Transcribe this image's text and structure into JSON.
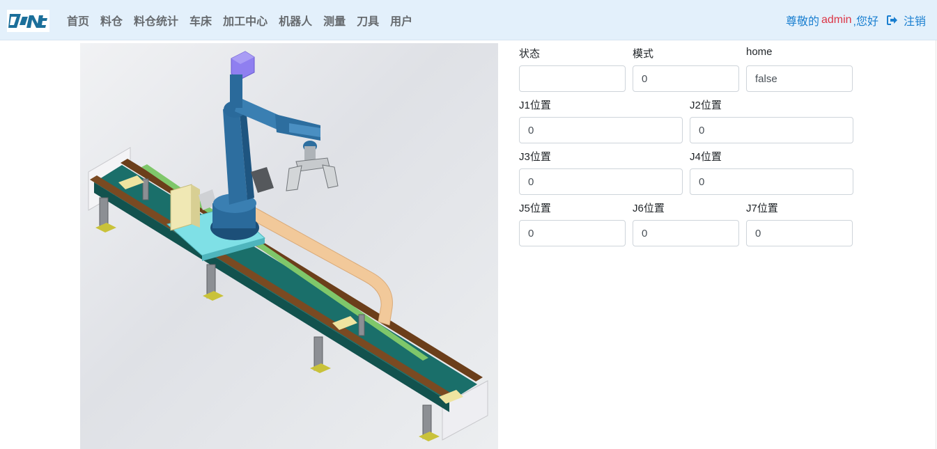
{
  "brand": {
    "logo_text": "CNC",
    "colors": {
      "navbar_bg": "#e3f0fb",
      "accent": "#1a7fd0",
      "user": "#dc3545"
    }
  },
  "nav": {
    "items": [
      {
        "label": "首页"
      },
      {
        "label": "料仓"
      },
      {
        "label": "料仓统计"
      },
      {
        "label": "车床"
      },
      {
        "label": "加工中心"
      },
      {
        "label": "机器人"
      },
      {
        "label": "测量"
      },
      {
        "label": "刀具"
      },
      {
        "label": "用户"
      }
    ]
  },
  "user": {
    "greeting_prefix": "尊敬的",
    "name": "admin",
    "greeting_suffix": ",您好",
    "logout_label": "注销",
    "logout_icon": "sign-out-icon"
  },
  "robot_image": {
    "icon": "robot-gantry-illustration"
  },
  "robot_status": {
    "state": {
      "label": "状态",
      "value": ""
    },
    "mode": {
      "label": "模式",
      "value": "0"
    },
    "home": {
      "label": "home",
      "value": "false"
    },
    "j1": {
      "label": "J1位置",
      "value": "0"
    },
    "j2": {
      "label": "J2位置",
      "value": "0"
    },
    "j3": {
      "label": "J3位置",
      "value": "0"
    },
    "j4": {
      "label": "J4位置",
      "value": "0"
    },
    "j5": {
      "label": "J5位置",
      "value": "0"
    },
    "j6": {
      "label": "J6位置",
      "value": "0"
    },
    "j7": {
      "label": "J7位置",
      "value": "0"
    }
  }
}
